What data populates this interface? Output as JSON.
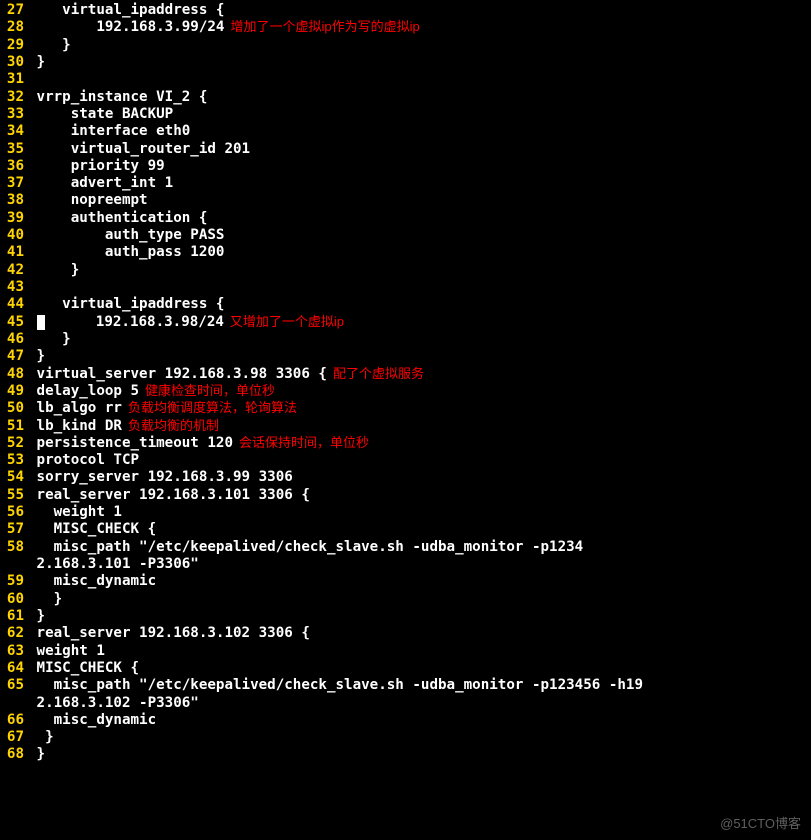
{
  "watermark": "@51CTO博客",
  "lines": [
    {
      "num": "27",
      "code": "    virtual_ipaddress {",
      "ann": ""
    },
    {
      "num": "28",
      "code": "        192.168.3.99/24",
      "ann": "增加了一个虚拟ip作为写的虚拟ip"
    },
    {
      "num": "29",
      "code": "    }",
      "ann": ""
    },
    {
      "num": "30",
      "code": " }",
      "ann": ""
    },
    {
      "num": "31",
      "code": "",
      "ann": ""
    },
    {
      "num": "32",
      "code": " vrrp_instance VI_2 {",
      "ann": ""
    },
    {
      "num": "33",
      "code": "     state BACKUP",
      "ann": ""
    },
    {
      "num": "34",
      "code": "     interface eth0",
      "ann": ""
    },
    {
      "num": "35",
      "code": "     virtual_router_id 201",
      "ann": ""
    },
    {
      "num": "36",
      "code": "     priority 99",
      "ann": ""
    },
    {
      "num": "37",
      "code": "     advert_int 1",
      "ann": ""
    },
    {
      "num": "38",
      "code": "     nopreempt",
      "ann": ""
    },
    {
      "num": "39",
      "code": "     authentication {",
      "ann": ""
    },
    {
      "num": "40",
      "code": "         auth_type PASS",
      "ann": ""
    },
    {
      "num": "41",
      "code": "         auth_pass 1200",
      "ann": ""
    },
    {
      "num": "42",
      "code": "     }",
      "ann": ""
    },
    {
      "num": "43",
      "code": "",
      "ann": ""
    },
    {
      "num": "44",
      "code": "    virtual_ipaddress {",
      "ann": ""
    },
    {
      "num": "45",
      "code": "        192.168.3.98/24",
      "ann": "又增加了一个虚拟ip",
      "cursor": true
    },
    {
      "num": "46",
      "code": "    }",
      "ann": ""
    },
    {
      "num": "47",
      "code": " }",
      "ann": ""
    },
    {
      "num": "48",
      "code": " virtual_server 192.168.3.98 3306 {",
      "ann": "配了个虚拟服务"
    },
    {
      "num": "49",
      "code": " delay_loop 5",
      "ann": "健康检查时间，单位秒"
    },
    {
      "num": "50",
      "code": " lb_algo rr",
      "ann": "负载均衡调度算法，轮询算法"
    },
    {
      "num": "51",
      "code": " lb_kind DR",
      "ann": "负载均衡的机制"
    },
    {
      "num": "52",
      "code": " persistence_timeout 120",
      "ann": "会话保持时间，单位秒"
    },
    {
      "num": "53",
      "code": " protocol TCP",
      "ann": ""
    },
    {
      "num": "54",
      "code": " sorry_server 192.168.3.99 3306",
      "ann": ""
    },
    {
      "num": "55",
      "code": " real_server 192.168.3.101 3306 {",
      "ann": ""
    },
    {
      "num": "56",
      "code": "   weight 1",
      "ann": ""
    },
    {
      "num": "57",
      "code": "   MISC_CHECK {",
      "ann": ""
    },
    {
      "num": "58",
      "code": "   misc_path \"/etc/keepalived/check_slave.sh -udba_monitor -p1234",
      "ann": ""
    },
    {
      "num": "",
      "code": " 2.168.3.101 -P3306\"",
      "ann": ""
    },
    {
      "num": "59",
      "code": "   misc_dynamic",
      "ann": ""
    },
    {
      "num": "60",
      "code": "   }",
      "ann": ""
    },
    {
      "num": "61",
      "code": " }",
      "ann": ""
    },
    {
      "num": "62",
      "code": " real_server 192.168.3.102 3306 {",
      "ann": ""
    },
    {
      "num": "63",
      "code": " weight 1",
      "ann": ""
    },
    {
      "num": "64",
      "code": " MISC_CHECK {",
      "ann": ""
    },
    {
      "num": "65",
      "code": "   misc_path \"/etc/keepalived/check_slave.sh -udba_monitor -p123456 -h19",
      "ann": ""
    },
    {
      "num": "",
      "code": " 2.168.3.102 -P3306\"",
      "ann": ""
    },
    {
      "num": "66",
      "code": "   misc_dynamic",
      "ann": ""
    },
    {
      "num": "67",
      "code": "  }",
      "ann": ""
    },
    {
      "num": "68",
      "code": " }",
      "ann": ""
    }
  ]
}
